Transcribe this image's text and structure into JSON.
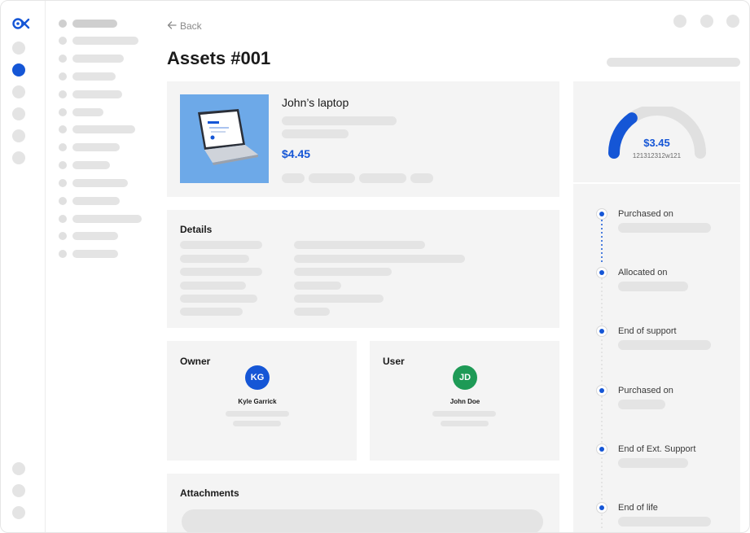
{
  "colors": {
    "accent": "#1556d6",
    "avatar_owner": "#1556d6",
    "avatar_user": "#1e9a56",
    "card_bg": "#f4f4f4",
    "placeholder": "#e4e4e4"
  },
  "header": {
    "back_label": "Back",
    "title": "Assets #001"
  },
  "asset": {
    "name": "John’s laptop",
    "price": "$4.45"
  },
  "gauge": {
    "value": "$3.45",
    "code": "121312312w121",
    "fill_fraction": 0.3
  },
  "details": {
    "title": "Details"
  },
  "owner": {
    "title": "Owner",
    "initials": "KG",
    "name": "Kyle Garrick"
  },
  "user": {
    "title": "User",
    "initials": "JD",
    "name": "John Doe"
  },
  "attachments": {
    "title": "Attachments"
  },
  "timeline": [
    {
      "label": "Purchased on"
    },
    {
      "label": "Allocated on"
    },
    {
      "label": "End of support"
    },
    {
      "label": "Purchased on"
    },
    {
      "label": "End of Ext. Support"
    },
    {
      "label": "End of life"
    }
  ],
  "icons": {
    "logo": "brand-logo-icon",
    "back": "arrow-left-icon"
  }
}
